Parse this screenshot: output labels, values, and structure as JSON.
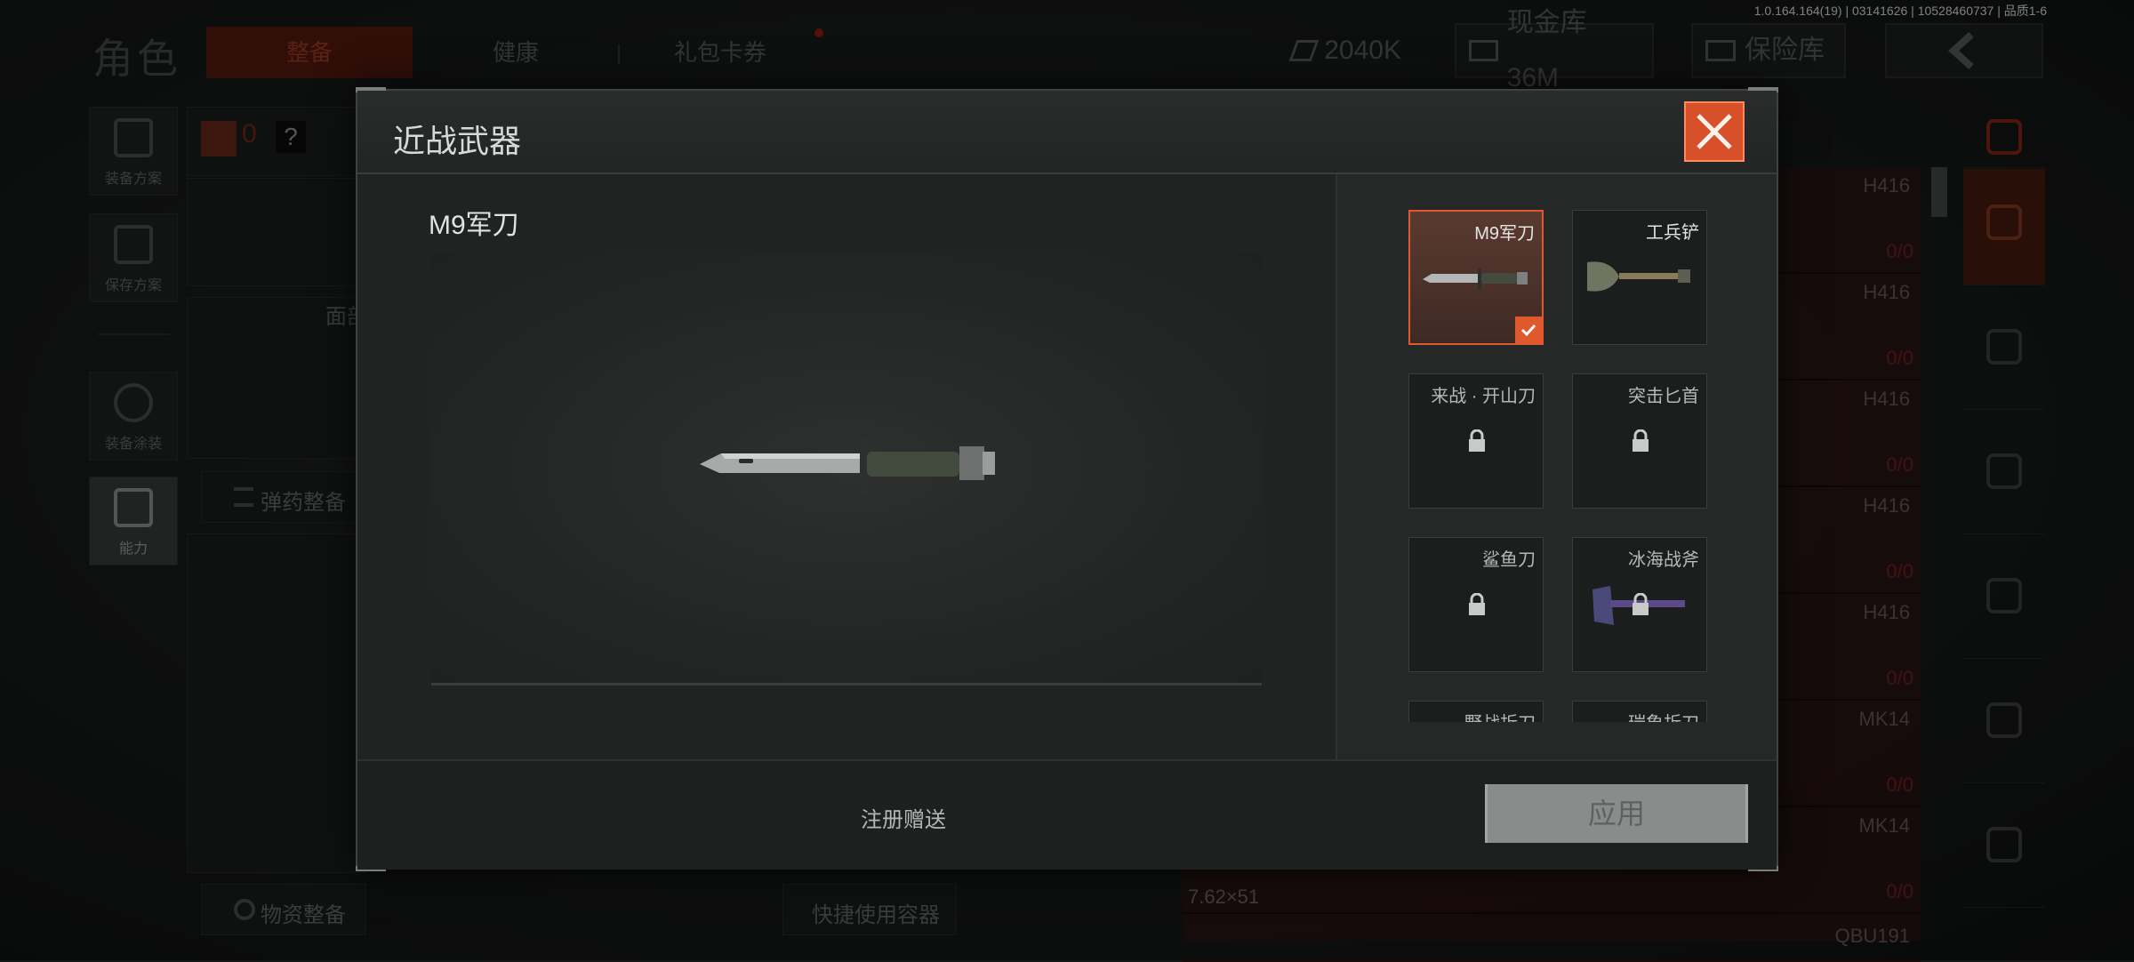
{
  "version": "1.0.164.164(19) | 03141626 | 10528460737 | 品质1-6",
  "header": {
    "page_title": "角色",
    "tabs": [
      {
        "label": "整备",
        "active": true
      },
      {
        "label": "健康",
        "active": false
      },
      {
        "label": "礼包卡券",
        "active": false
      }
    ],
    "currency": "2040K",
    "cash_vault": "现金库 36M",
    "safe_box": "保险库"
  },
  "left_sidebar": {
    "items": [
      {
        "label": "装备方案",
        "icon": "vest-icon"
      },
      {
        "label": "保存方案",
        "icon": "download-icon"
      },
      {
        "label": "装备涂装",
        "icon": "helmet-icon"
      },
      {
        "label": "能力",
        "icon": "lightning-hex-icon"
      }
    ]
  },
  "loadout": {
    "count": "0",
    "help": "?",
    "face_label": "面部",
    "ammo_label": "弹药整备",
    "supplies_label": "物资整备",
    "quick_container": "快捷使用容器",
    "ammo_type": "7.62×51"
  },
  "weapon_list": [
    {
      "name": "H416",
      "count": "0/0"
    },
    {
      "name": "H416",
      "count": "0/0"
    },
    {
      "name": "H416",
      "count": "0/0"
    },
    {
      "name": "H416",
      "count": "0/0"
    },
    {
      "name": "H416",
      "count": "0/0"
    },
    {
      "name": "MK14",
      "count": "0/0"
    },
    {
      "name": "MK14",
      "count": "0/0"
    },
    {
      "name": "QBU191",
      "count": ""
    }
  ],
  "modal": {
    "title": "近战武器",
    "selected_name": "M9军刀",
    "source": "注册赠送",
    "apply_label": "应用",
    "items": [
      {
        "name": "M9军刀",
        "selected": true,
        "locked": false
      },
      {
        "name": "工兵铲",
        "selected": false,
        "locked": false
      },
      {
        "name": "来战 · 开山刀",
        "selected": false,
        "locked": true
      },
      {
        "name": "突击匕首",
        "selected": false,
        "locked": true
      },
      {
        "name": "鲨鱼刀",
        "selected": false,
        "locked": true
      },
      {
        "name": "冰海战斧",
        "selected": false,
        "locked": true
      },
      {
        "name": "野战折刀",
        "selected": false,
        "locked": true
      },
      {
        "name": "瑞象折刀",
        "selected": false,
        "locked": true
      }
    ]
  },
  "colors": {
    "accent": "#e0592e",
    "close_button": "#d8502a",
    "apply_disabled": "#8a8c8b"
  }
}
